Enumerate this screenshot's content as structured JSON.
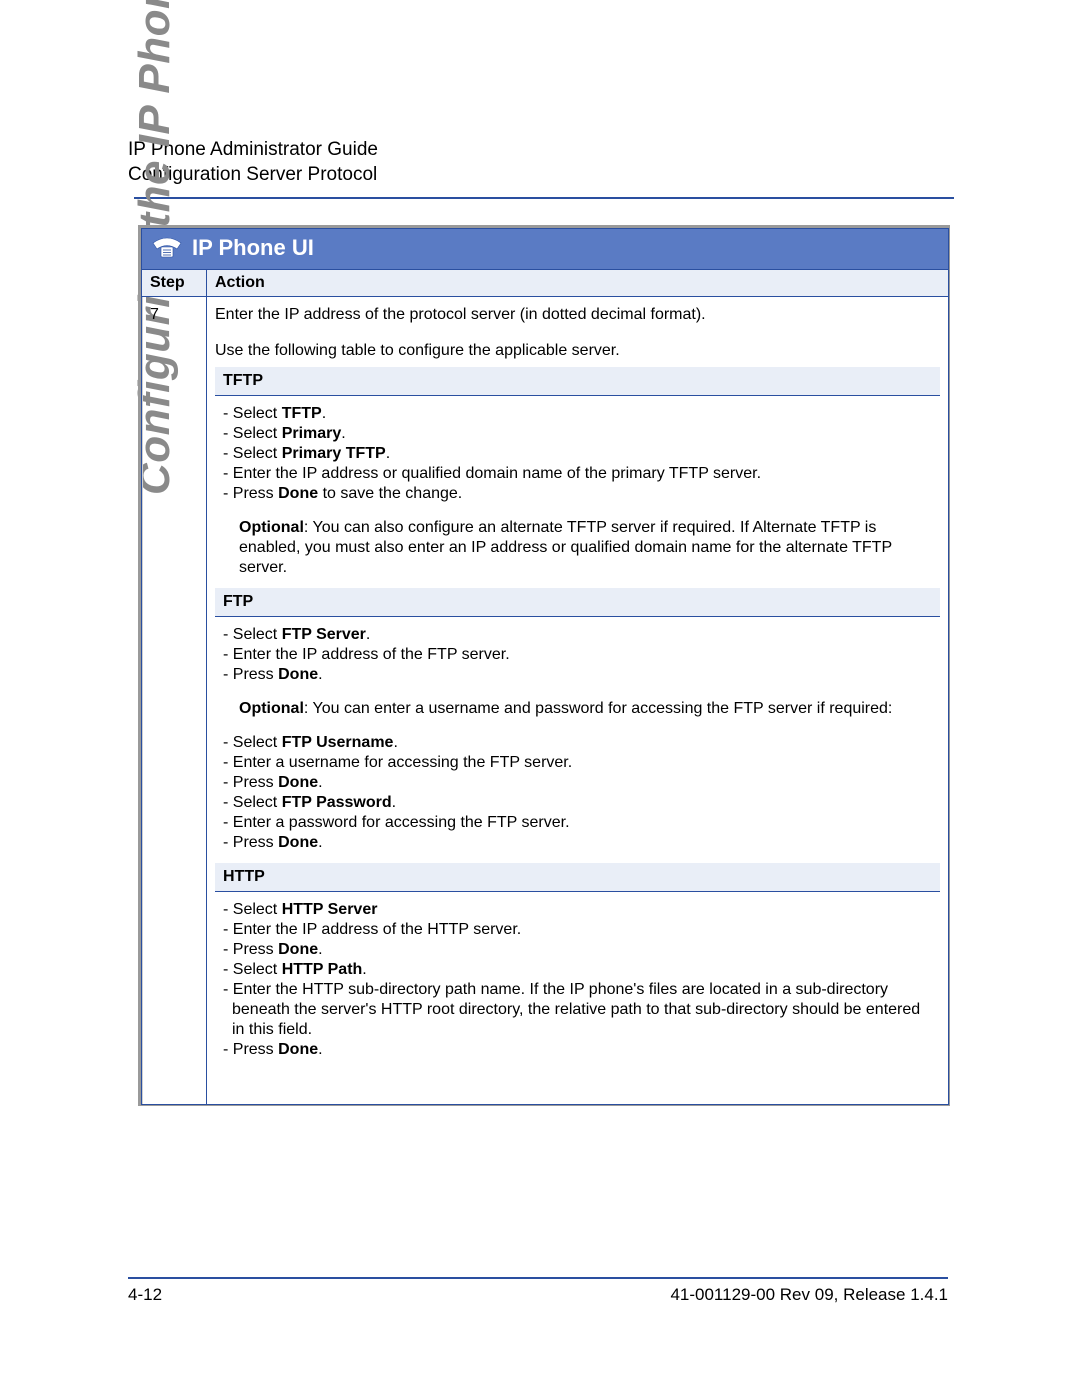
{
  "header": {
    "line1": "IP Phone Administrator Guide",
    "line2": "Configuration Server Protocol"
  },
  "side_title": "Configuring the IP Phones",
  "panel_title": "IP Phone UI",
  "table": {
    "col1": "Step",
    "col2": "Action",
    "step_num": "7",
    "intro1": "Enter the IP address of the protocol server (in dotted decimal format).",
    "intro2": "Use the following table to configure the applicable server.",
    "tftp": {
      "header": "TFTP",
      "l1a": "- Select ",
      "l1b": "TFTP",
      "l1c": ".",
      "l2a": "- Select ",
      "l2b": "Primary",
      "l2c": ".",
      "l3a": "- Select ",
      "l3b": "Primary TFTP",
      "l3c": ".",
      "l4": "- Enter the IP address or qualified domain name of the primary TFTP server.",
      "l5a": "- Press ",
      "l5b": "Done",
      "l5c": " to save the change.",
      "opt_label": "Optional",
      "opt_text": ": You can also configure an alternate TFTP server if required. If Alternate TFTP is enabled, you must also enter an IP address or qualified domain name for the alternate TFTP server."
    },
    "ftp": {
      "header": "FTP",
      "l1a": "- Select ",
      "l1b": "FTP Server",
      "l1c": ".",
      "l2": "- Enter the IP address of the FTP server.",
      "l3a": "- Press ",
      "l3b": "Done",
      "l3c": ".",
      "opt_label": "Optional",
      "opt_text": ": You can enter a username and password for accessing the FTP server if required:",
      "l4a": "- Select ",
      "l4b": "FTP Username",
      "l4c": ".",
      "l5": "- Enter a username for accessing the FTP server.",
      "l6a": "- Press ",
      "l6b": "Done",
      "l6c": ".",
      "l7a": "- Select ",
      "l7b": "FTP Password",
      "l7c": ".",
      "l8": "- Enter a password for accessing the FTP server.",
      "l9a": "- Press ",
      "l9b": "Done",
      "l9c": "."
    },
    "http": {
      "header": "HTTP",
      "l1a": "- Select ",
      "l1b": "HTTP Server",
      "l2": "- Enter the IP address of the HTTP server.",
      "l3a": "- Press ",
      "l3b": "Done",
      "l3c": ".",
      "l4a": "- Select ",
      "l4b": "HTTP Path",
      "l4c": ".",
      "l5": "- Enter the HTTP sub-directory path name. If the IP phone's files are located in a sub-directory beneath the server's HTTP root directory, the relative path to that sub-directory should be entered in this field.",
      "l6a": "- Press ",
      "l6b": "Done",
      "l6c": "."
    }
  },
  "footer": {
    "page": "4-12",
    "doc": "41-001129-00 Rev 09, Release 1.4.1"
  }
}
